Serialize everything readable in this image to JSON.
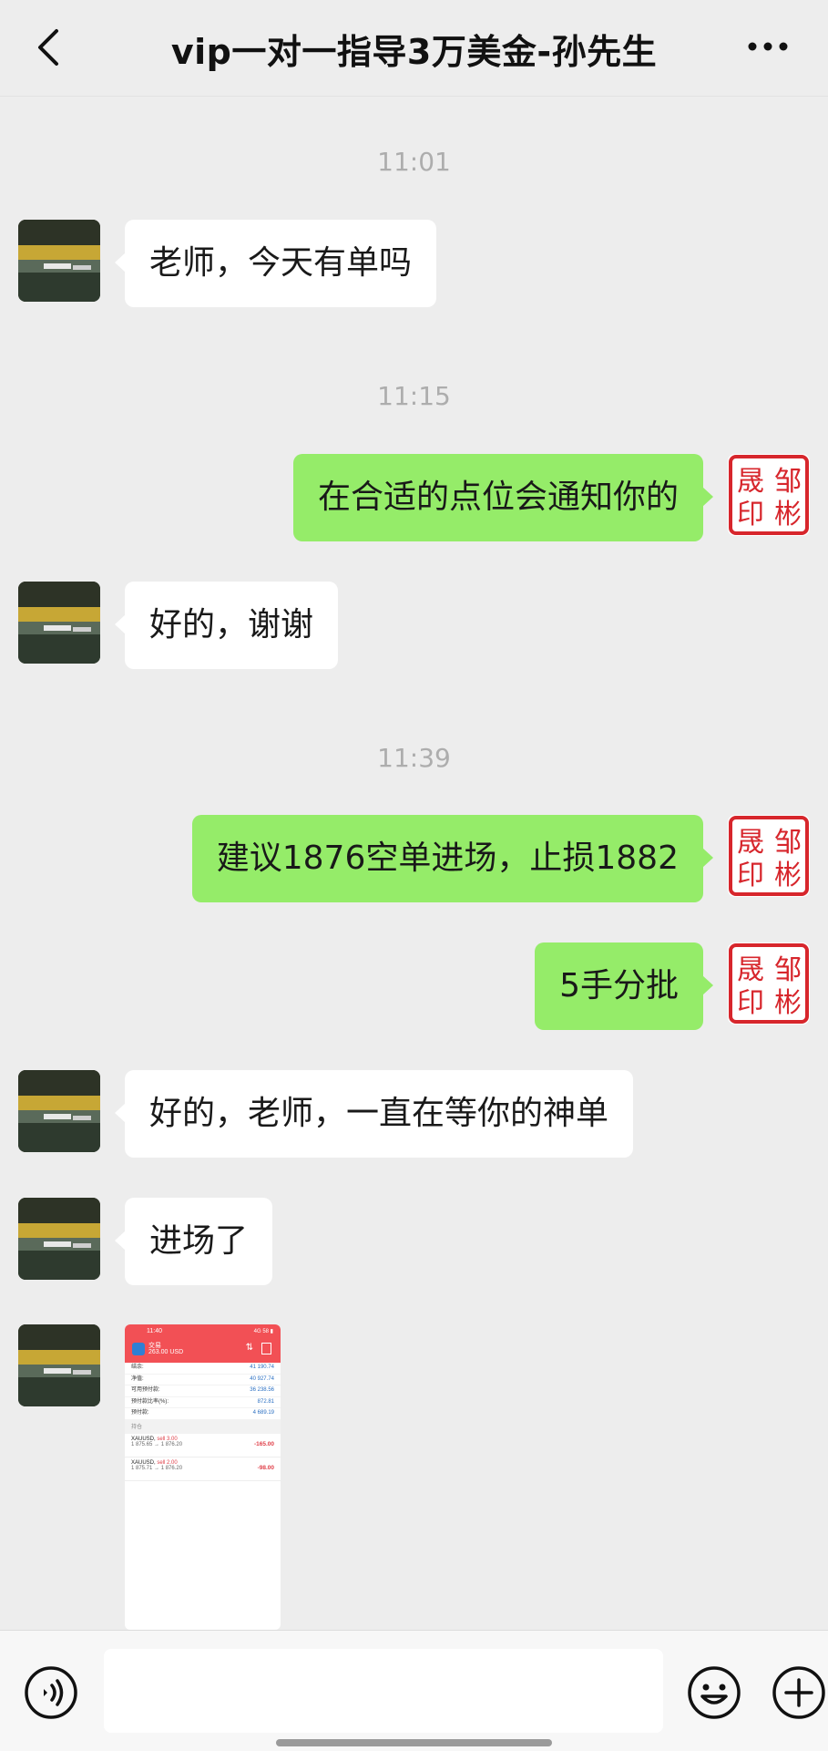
{
  "header": {
    "title": "vip一对一指导3万美金-孙先生",
    "back_icon": "chevron-left-icon",
    "more_icon": "more-dots-icon"
  },
  "seal_text": [
    "邹",
    "彬",
    "晟",
    "印"
  ],
  "messages": [
    {
      "type": "time",
      "text": "11:01"
    },
    {
      "type": "in",
      "text": "老师，今天有单吗"
    },
    {
      "type": "time",
      "text": "11:15"
    },
    {
      "type": "out",
      "text": "在合适的点位会通知你的"
    },
    {
      "type": "in",
      "text": "好的，谢谢"
    },
    {
      "type": "time",
      "text": "11:39"
    },
    {
      "type": "out",
      "text": "建议1876空单进场，止损1882"
    },
    {
      "type": "out",
      "text": "5手分批"
    },
    {
      "type": "in",
      "text": "好的，老师，一直在等你的神单"
    },
    {
      "type": "in",
      "text": "进场了"
    },
    {
      "type": "in-image",
      "text": ""
    }
  ],
  "screenshot": {
    "time": "11:40",
    "status": "4G 58 ▮",
    "account_name": "交易",
    "account_balance": "263.00 USD",
    "rows": [
      {
        "label": "结余:",
        "value": "41 190.74"
      },
      {
        "label": "净值:",
        "value": "40 927.74"
      },
      {
        "label": "可用预付款:",
        "value": "36 238.56"
      },
      {
        "label": "预付款比率(%):",
        "value": "872.81"
      },
      {
        "label": "预付款:",
        "value": "4 689.19"
      }
    ],
    "positions_title": "持仓",
    "positions": [
      {
        "symbol": "XAUUSD,",
        "side": "sell 3.00",
        "prices": "1 875.65 → 1 876.20",
        "pl": "-165.00"
      },
      {
        "symbol": "XAUUSD,",
        "side": "sell 2.00",
        "prices": "1 875.71 → 1 876.20",
        "pl": "-98.00"
      }
    ]
  },
  "input": {
    "placeholder": ""
  },
  "colors": {
    "outgoing": "#95ec69",
    "incoming": "#ffffff",
    "background": "#ededed",
    "seal": "#d7262c"
  }
}
